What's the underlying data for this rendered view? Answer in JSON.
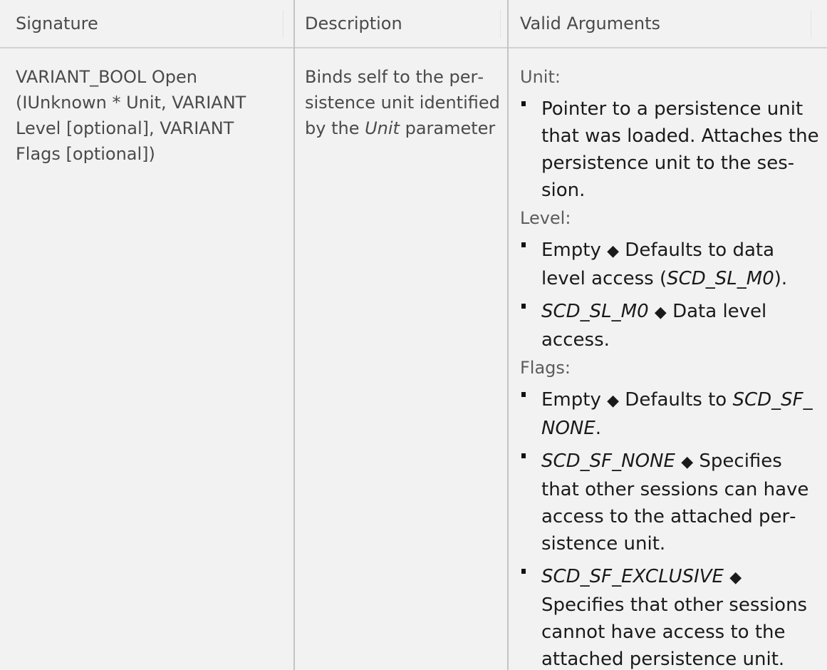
{
  "table": {
    "headers": [
      "Signature",
      "Description",
      "Valid Arguments"
    ],
    "row": {
      "signature": "VARIANT_BOOL Open (IUnknown * Unit, VARIANT Level [optional], VARIANT Flags [optional])",
      "description": {
        "before": "Binds self to the per­sistence unit iden­tified by the ",
        "emphasis": "Unit",
        "after": " parameter"
      },
      "arguments": [
        {
          "label": "Unit:",
          "items": [
            {
              "text": "Pointer to a persistence unit that was loaded. Attaches the persistence unit to the ses­sion."
            }
          ]
        },
        {
          "label": "Level:",
          "items": [
            {
              "term": "Empty",
              "italic_term": false,
              "symbol": "◆",
              "text_before": " Defaults to data level access (",
              "italic": "SCD_SL_M0",
              "text_after": ")."
            },
            {
              "term": "SCD_SL_M0",
              "italic_term": true,
              "symbol": "◆",
              "text_before": " Data level access.",
              "italic": "",
              "text_after": ""
            }
          ]
        },
        {
          "label": "Flags:",
          "items": [
            {
              "term": "Empty",
              "italic_term": false,
              "symbol": "◆",
              "text_before": " Defaults to ",
              "italic": "SCD_SF_​NONE",
              "text_after": "."
            },
            {
              "term": "SCD_SF_NONE",
              "italic_term": true,
              "symbol": "◆",
              "text_before": " Specifies that other sessions can have access to the attached per­sistence unit.",
              "italic": "",
              "text_after": ""
            },
            {
              "term": "SCD_SF_EXCLUSIVE",
              "italic_term": true,
              "symbol": "◆",
              "text_before": " Specifies that other sessions cannot have access to the attached persistence unit.",
              "italic": "",
              "text_after": ""
            }
          ]
        }
      ]
    }
  }
}
